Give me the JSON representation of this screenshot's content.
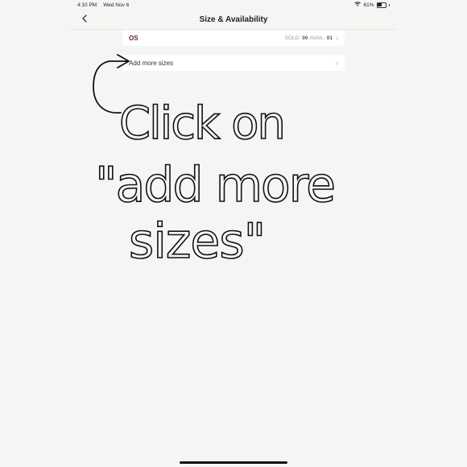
{
  "status_bar": {
    "time": "4:10 PM",
    "date": "Wed Nov 6",
    "battery_percent": "61%",
    "battery_level": 0.61
  },
  "nav": {
    "title": "Size & Availability"
  },
  "sizes": [
    {
      "size": "OS",
      "sold_label": "SOLD:",
      "sold_value": "00",
      "avail_label": "AVAIL:",
      "avail_value": "01"
    }
  ],
  "add_more": {
    "label": "Add more sizes"
  },
  "annotation": {
    "line1": "Click on",
    "line2": "\"add more",
    "line3": "sizes\""
  },
  "colors": {
    "size_accent": "#6a1a4c",
    "background": "#f6f5f3"
  }
}
